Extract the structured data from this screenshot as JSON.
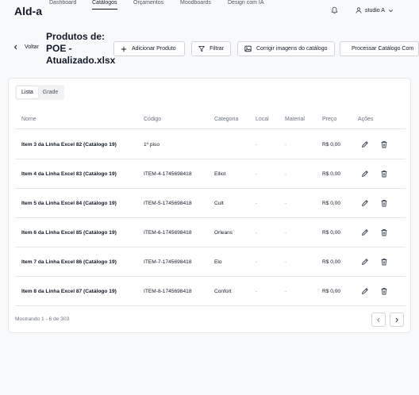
{
  "app": {
    "brand": "Ald-a"
  },
  "nav": {
    "items": [
      {
        "label": "Dashboard",
        "active": false
      },
      {
        "label": "Catálogos",
        "active": true
      },
      {
        "label": "Orçamentos",
        "active": false
      },
      {
        "label": "Moodboards",
        "active": false
      },
      {
        "label": "Design com IA",
        "active": false
      }
    ],
    "user_name": "studio A"
  },
  "header": {
    "back_label": "Voltar",
    "title": "Produtos de: POE - Atualizado.xlsx",
    "buttons": {
      "add_product": "Adicionar Produto",
      "filter": "Filtrar",
      "fix_images": "Corrigir imagens do catálogo",
      "process_catalog": "Processar Catálogo Com"
    }
  },
  "view_tabs": {
    "list": "Lista",
    "grid": "Grade",
    "active": "Lista"
  },
  "table": {
    "columns": {
      "name": "Nome",
      "code": "Código",
      "category": "Categoria",
      "location": "Local",
      "material": "Material",
      "price": "Preço",
      "actions": "Ações"
    },
    "rows": [
      {
        "name": "Item 3 da Linha Excel 82 (Catálogo 19)",
        "code": "1º piso",
        "category": "",
        "location": "-",
        "material": "-",
        "price": "R$ 0,00"
      },
      {
        "name": "Item 4 da Linha Excel 83 (Catálogo 19)",
        "code": "ITEM-4-1745698418",
        "category": "Elliot",
        "location": "-",
        "material": "-",
        "price": "R$ 0,00"
      },
      {
        "name": "Item 5 da Linha Excel 84 (Catálogo 19)",
        "code": "ITEM-5-1745698418",
        "category": "Cult",
        "location": "-",
        "material": "-",
        "price": "R$ 0,00"
      },
      {
        "name": "Item 6 da Linha Excel 85 (Catálogo 19)",
        "code": "ITEM-6-1745698418",
        "category": "Orleans",
        "location": "-",
        "material": "-",
        "price": "R$ 0,00"
      },
      {
        "name": "Item 7 da Linha Excel 86 (Catálogo 19)",
        "code": "ITEM-7-1745698418",
        "category": "Elo",
        "location": "-",
        "material": "-",
        "price": "R$ 0,00"
      },
      {
        "name": "Item 8 da Linha Excel 87 (Catálogo 19)",
        "code": "ITEM-8-1745698418",
        "category": "Confort",
        "location": "-",
        "material": "-",
        "price": "R$ 0,00"
      }
    ]
  },
  "pagination": {
    "summary": "Mostrando 1 - 6 de 303"
  },
  "icons": {
    "bell": "bell-icon",
    "user": "user-icon",
    "chevron_down": "chevron-down-icon",
    "back": "chevron-left-icon",
    "add": "plus-icon",
    "filter": "filter-icon",
    "image": "image-icon",
    "document": "document-icon",
    "edit": "pencil-icon",
    "delete": "trash-icon",
    "prev": "chevron-left-icon",
    "next": "chevron-right-icon"
  },
  "colors": {
    "text": "#111827",
    "muted": "#6b7280",
    "border": "#e5e7eb",
    "background": "#f8f9fa"
  }
}
